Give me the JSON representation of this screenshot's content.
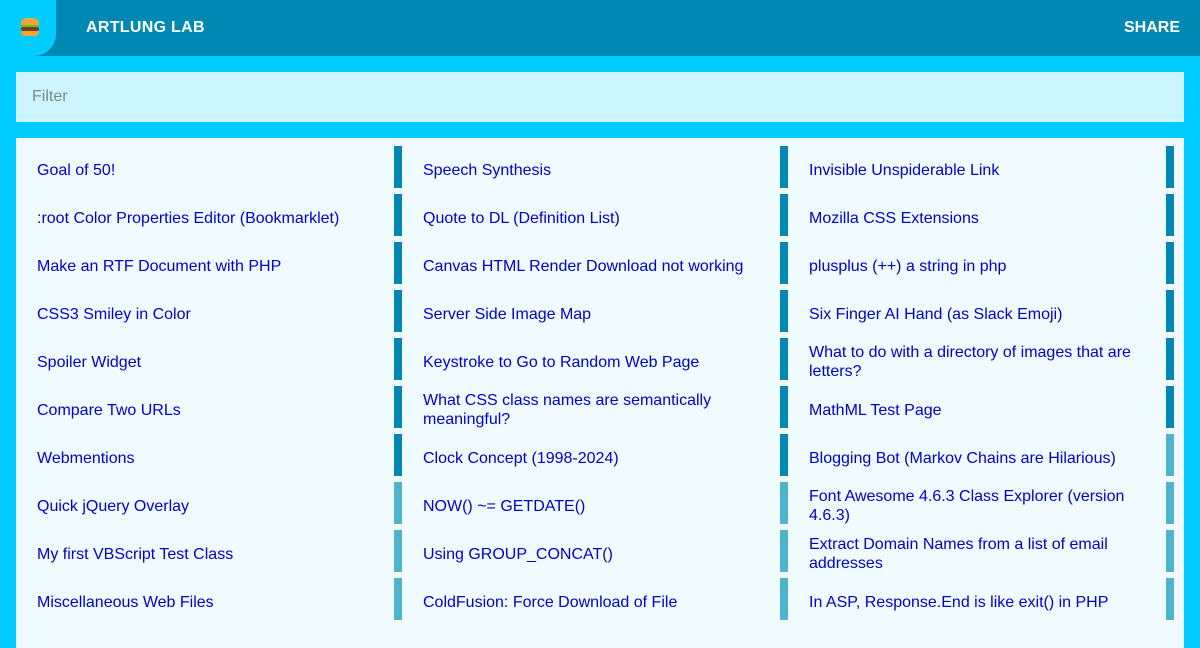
{
  "header": {
    "logo_icon": "hamburger-icon",
    "title": "ARTLUNG LAB",
    "share_label": "SHARE",
    "colors": {
      "bar": "#0088b4",
      "background": "#00ccff"
    }
  },
  "filter": {
    "placeholder": "Filter",
    "value": ""
  },
  "links": [
    "Goal of 50!",
    "Speech Synthesis",
    "Invisible Unspiderable Link",
    ":root Color Properties Editor (Bookmarklet)",
    "Quote to DL (Definition List)",
    "Mozilla CSS Extensions",
    "Make an RTF Document with PHP",
    "Canvas HTML Render Download not working",
    "plusplus (++) a string in php",
    "CSS3 Smiley in Color",
    "Server Side Image Map",
    "Six Finger AI Hand (as Slack Emoji)",
    "Spoiler Widget",
    "Keystroke to Go to Random Web Page",
    "What to do with a directory of images that are letters?",
    "Compare Two URLs",
    "What CSS class names are semantically meaningful?",
    "MathML Test Page",
    "Webmentions",
    "Clock Concept (1998-2024)",
    "Blogging Bot (Markov Chains are Hilarious)",
    "Quick jQuery Overlay",
    "NOW() ~= GETDATE()",
    "Font Awesome 4.6.3 Class Explorer (version 4.6.3)",
    "My first VBScript Test Class",
    "Using GROUP_CONCAT()",
    "Extract Domain Names from a list of email addresses",
    "Miscellaneous Web Files",
    "ColdFusion: Force Download of File",
    "In ASP, Response.End is like exit() in PHP"
  ]
}
